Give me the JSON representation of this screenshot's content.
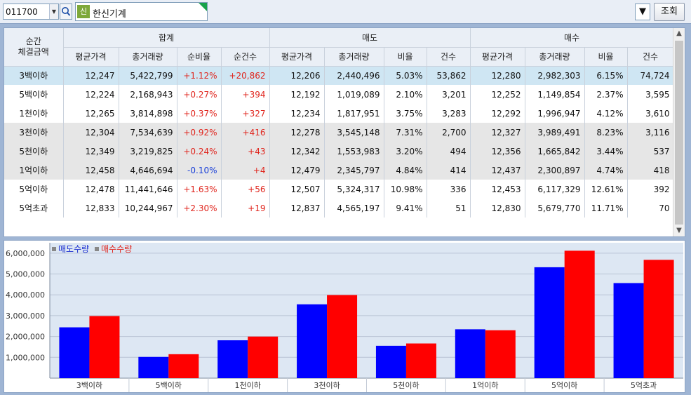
{
  "toolbar": {
    "code": "011700",
    "badge": "신",
    "name": "한신기계",
    "query_label": "조회",
    "menu_symbol": "▼"
  },
  "table": {
    "corner_header": [
      "순간",
      "체결금액"
    ],
    "groups": [
      "합계",
      "매도",
      "매수"
    ],
    "columns": [
      "평균가격",
      "총거래량",
      "순비율",
      "순건수",
      "평균가격",
      "총거래량",
      "비율",
      "건수",
      "평균가격",
      "총거래량",
      "비율",
      "건수"
    ],
    "rows": [
      {
        "label": "3백이하",
        "cells": [
          "12,247",
          "5,422,799",
          "+1.12%",
          "+20,862",
          "12,206",
          "2,440,496",
          "5.03%",
          "53,862",
          "12,280",
          "2,982,303",
          "6.15%",
          "74,724"
        ]
      },
      {
        "label": "5백이하",
        "cells": [
          "12,224",
          "2,168,943",
          "+0.27%",
          "+394",
          "12,192",
          "1,019,089",
          "2.10%",
          "3,201",
          "12,252",
          "1,149,854",
          "2.37%",
          "3,595"
        ]
      },
      {
        "label": "1천이하",
        "cells": [
          "12,265",
          "3,814,898",
          "+0.37%",
          "+327",
          "12,234",
          "1,817,951",
          "3.75%",
          "3,283",
          "12,292",
          "1,996,947",
          "4.12%",
          "3,610"
        ]
      },
      {
        "label": "3천이하",
        "cells": [
          "12,304",
          "7,534,639",
          "+0.92%",
          "+416",
          "12,278",
          "3,545,148",
          "7.31%",
          "2,700",
          "12,327",
          "3,989,491",
          "8.23%",
          "3,116"
        ]
      },
      {
        "label": "5천이하",
        "cells": [
          "12,349",
          "3,219,825",
          "+0.24%",
          "+43",
          "12,342",
          "1,553,983",
          "3.20%",
          "494",
          "12,356",
          "1,665,842",
          "3.44%",
          "537"
        ]
      },
      {
        "label": "1억이하",
        "cells": [
          "12,458",
          "4,646,694",
          "-0.10%",
          "+4",
          "12,479",
          "2,345,797",
          "4.84%",
          "414",
          "12,437",
          "2,300,897",
          "4.74%",
          "418"
        ]
      },
      {
        "label": "5억이하",
        "cells": [
          "12,478",
          "11,441,646",
          "+1.63%",
          "+56",
          "12,507",
          "5,324,317",
          "10.98%",
          "336",
          "12,453",
          "6,117,329",
          "12.61%",
          "392"
        ]
      },
      {
        "label": "5억초과",
        "cells": [
          "12,833",
          "10,244,967",
          "+2.30%",
          "+19",
          "12,837",
          "4,565,197",
          "9.41%",
          "51",
          "12,830",
          "5,679,770",
          "11.71%",
          "70"
        ]
      }
    ]
  },
  "colors": {
    "sell": "#0000ff",
    "buy": "#ff0000",
    "positive": "#e0251d",
    "negative": "#1a40d8",
    "selected_row": "#cfe6f3"
  },
  "chart_data": {
    "type": "bar",
    "categories": [
      "3백이하",
      "5백이하",
      "1천이하",
      "3천이하",
      "5천이하",
      "1억이하",
      "5억이하",
      "5억초과"
    ],
    "series": [
      {
        "name": "매도수량",
        "values": [
          2440496,
          1019089,
          1817951,
          3545148,
          1553983,
          2345797,
          5324317,
          4565197
        ]
      },
      {
        "name": "매수수량",
        "values": [
          2982303,
          1149854,
          1996947,
          3989491,
          1665842,
          2300897,
          6117329,
          5679770
        ]
      }
    ],
    "ytick_labels": [
      "1,000,000",
      "2,000,000",
      "3,000,000",
      "4,000,000",
      "5,000,000",
      "6,000,000"
    ],
    "ylim": [
      0,
      6500000
    ],
    "grid": true,
    "legend": "top-left"
  }
}
